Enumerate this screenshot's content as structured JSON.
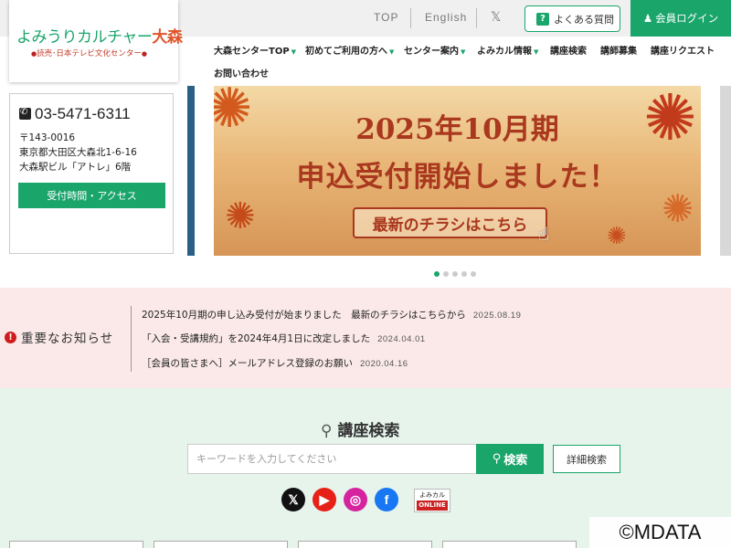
{
  "header": {
    "logo_main": "よみうりカルチャー",
    "logo_mori": "大森",
    "logo_sub": "読売･日本テレビ文化センター",
    "top_label": "TOP",
    "english_label": "English",
    "x_label": "𝕏",
    "faq_label": "よくある質問",
    "login_label": "会員ログイン",
    "brand_color": "#1aa56b"
  },
  "nav": {
    "items": [
      {
        "label": "大森センターTOP",
        "caret": true
      },
      {
        "label": "初めてご利用の方へ",
        "caret": true
      },
      {
        "label": "センター案内",
        "caret": true
      },
      {
        "label": "よみカル情報",
        "caret": true
      },
      {
        "label": "講座検索",
        "caret": false
      },
      {
        "label": "講師募集",
        "caret": false
      },
      {
        "label": "講座リクエスト",
        "caret": false
      },
      {
        "label": "お問い合わせ",
        "caret": false
      }
    ]
  },
  "contact": {
    "phone": "03-5471-6311",
    "zip": "〒143-0016",
    "address1": "東京都大田区大森北1-6-16",
    "address2": "大森駅ビル「アトレ」6階",
    "access_label": "受付時間・アクセス"
  },
  "banner": {
    "line1": "2025年10月期",
    "line2": "申込受付開始しました！",
    "button": "最新のチラシはこちら"
  },
  "slider": {
    "count": 5,
    "active": 1
  },
  "notice": {
    "heading": "重要なお知らせ",
    "items": [
      {
        "text": "2025年10月期の申し込み受付が始まりました　最新のチラシはこちらから",
        "date": "2025.08.19"
      },
      {
        "text": "「入会・受講規約」を2024年4月1日に改定しました",
        "date": "2024.04.01"
      },
      {
        "text": "［会員の皆さまへ］メールアドレス登録のお願い",
        "date": "2020.04.16"
      }
    ]
  },
  "search": {
    "title": "講座検索",
    "placeholder": "キーワードを入力してください",
    "button": "検索",
    "advanced": "詳細検索"
  },
  "social": [
    {
      "icon": "x-icon",
      "glyph": "𝕏",
      "color": "#111111"
    },
    {
      "icon": "youtube-icon",
      "glyph": "▶",
      "color": "#e62117"
    },
    {
      "icon": "instagram-icon",
      "glyph": "◎",
      "color": "#d6249f"
    },
    {
      "icon": "facebook-icon",
      "glyph": "f",
      "color": "#1877f2"
    }
  ],
  "online_badge": {
    "top": "よみカル",
    "bottom": "ONLINE"
  },
  "watermark": "©MDATA"
}
